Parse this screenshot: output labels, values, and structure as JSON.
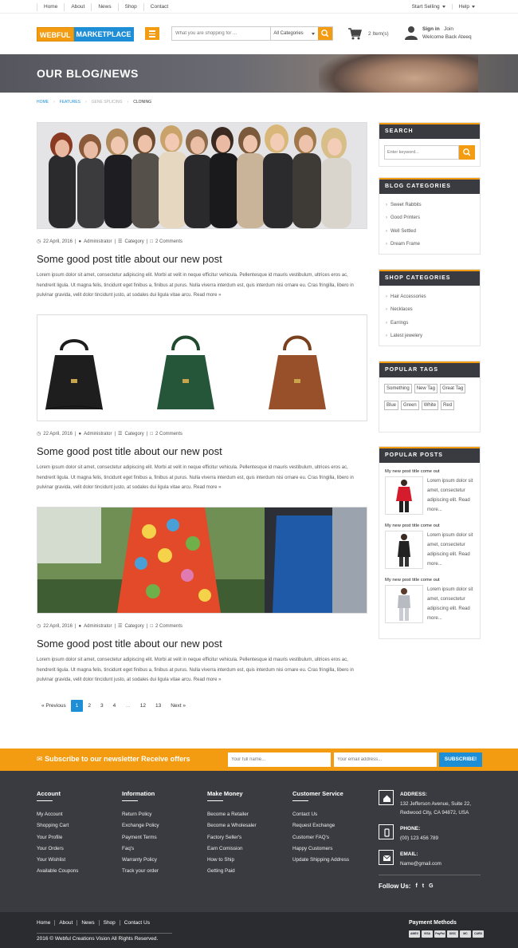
{
  "topbar": {
    "nav": [
      "Home",
      "About",
      "News",
      "Shop",
      "Contact"
    ],
    "start_selling": "Start Selling",
    "help": "Help"
  },
  "header": {
    "logo_part1": "WEBFUL",
    "logo_part2": "MARKETPLACE",
    "search_placeholder": "What you are shopping for ...",
    "category_select": "All Categories",
    "cart_count": "2 Item(s)",
    "sign_in": "Sign in",
    "join": "Join",
    "welcome": "Welcome Back Ateeq"
  },
  "banner": {
    "title": "OUR BLOG/NEWS"
  },
  "breadcrumb": [
    "HOME",
    "FEATURES",
    "GENE SPLICING",
    "CLONING"
  ],
  "posts": [
    {
      "date": "22 April, 2016",
      "author": "Administrator",
      "category": "Category",
      "comments": "2 Comments",
      "title": "Some good post title about our new post",
      "excerpt": "Lorem ipsum dolor sit amet, consectetur adipiscing elit. Morbi at velit in neque efficitur vehicula. Pellentesque id mauris vestibulum, ultrices eros ac, hendrerit ligula. Ut magna felis, tincidunt eget finibus a, finibus at purus. Nulla viverra interdum est, quis interdum nisi ornare eu. Cras fringilla, libero in pulvinar gravida, velit dolor tincidunt justo, at sodales dui ligula vitae arcu.",
      "read_more": "Read more »"
    },
    {
      "date": "22 April, 2016",
      "author": "Administrator",
      "category": "Category",
      "comments": "2 Comments",
      "title": "Some good post title about our new post",
      "excerpt": "Lorem ipsum dolor sit amet, consectetur adipiscing elit. Morbi at velit in neque efficitur vehicula. Pellentesque id mauris vestibulum, ultrices eros ac, hendrerit ligula. Ut magna felis, tincidunt eget finibus a, finibus at purus. Nulla viverra interdum est, quis interdum nisi ornare eu. Cras fringilla, libero in pulvinar gravida, velit dolor tincidunt justo, at sodales dui ligula vitae arcu.",
      "read_more": "Read more »"
    },
    {
      "date": "22 April, 2016",
      "author": "Administrator",
      "category": "Category",
      "comments": "2 Comments",
      "title": "Some good post title about our new post",
      "excerpt": "Lorem ipsum dolor sit amet, consectetur adipiscing elit. Morbi at velit in neque efficitur vehicula. Pellentesque id mauris vestibulum, ultrices eros ac, hendrerit ligula. Ut magna felis, tincidunt eget finibus a, finibus at purus. Nulla viverra interdum est, quis interdum nisi ornare eu. Cras fringilla, libero in pulvinar gravida, velit dolor tincidunt justo, at sodales dui ligula vitae arcu.",
      "read_more": "Read more »"
    }
  ],
  "pagination": {
    "prev": "« Previous",
    "pages": [
      "1",
      "2",
      "3",
      "4",
      "…",
      "12",
      "13"
    ],
    "active": "1",
    "next": "Next »"
  },
  "sidebar": {
    "search": {
      "title": "SEARCH",
      "placeholder": "Enter keyword..."
    },
    "blog_categories": {
      "title": "BLOG CATEGORIES",
      "items": [
        "Sweet Rabbits",
        "Good Printers",
        "Well Settled",
        "Dream Frame"
      ]
    },
    "shop_categories": {
      "title": "SHOP CATEGORIES",
      "items": [
        "Hair Accessories",
        "Necklaces",
        "Earrings",
        "Latest jewelery"
      ]
    },
    "popular_tags": {
      "title": "POPULAR TAGS",
      "tags": [
        "Something",
        "New Tag",
        "Great Tag",
        "Blue",
        "Green",
        "White",
        "Red"
      ]
    },
    "popular_posts": {
      "title": "POPULAR POSTS",
      "items": [
        {
          "title": "My new post title come out",
          "desc": "Lorem ipsum dolor sit amet, consectetur adipiscing elit. Read more..."
        },
        {
          "title": "My new post title come out",
          "desc": "Lorem ipsum dolor sit amet, consectetur adipiscing elit. Read more..."
        },
        {
          "title": "My new post title come out",
          "desc": "Lorem ipsum dolor sit amet, consectetur adipiscing elit. Read more..."
        }
      ]
    }
  },
  "newsletter": {
    "title": "Subscribe to our newsletter Receive offers",
    "name_placeholder": "Your full name...",
    "email_placeholder": "Your email address...",
    "button": "SUBSCRIBE!"
  },
  "footer": {
    "columns": [
      {
        "title": "Account",
        "links": [
          "My Account",
          "Shopping Cart",
          "Your Profile",
          "Your Orders",
          "Your Wishlist",
          "Available Coupons"
        ]
      },
      {
        "title": "Information",
        "links": [
          "Return Policy",
          "Exchange Policy",
          "Payment Terms",
          "Faq's",
          "Warranty Policy",
          "Track your order"
        ]
      },
      {
        "title": "Make Money",
        "links": [
          "Become a Retailer",
          "Become a Wholesaler",
          "Factory Seller's",
          "Earn Comission",
          "How to Ship",
          "Getting Paid"
        ]
      },
      {
        "title": "Customer Service",
        "links": [
          "Contact Us",
          "Request Exchange",
          "Customer FAQ's",
          "Happy Customers",
          "Update Shipping Address"
        ]
      }
    ],
    "address_label": "ADDRESS:",
    "address": "132 Jefferson Avenue, Suite 22, Redwood City, CA 94872, USA",
    "phone_label": "PHONE:",
    "phone": "(00) 123 456 789",
    "email_label": "EMAIL:",
    "email": "Name@gmail.com",
    "follow": "Follow Us:",
    "social": [
      "f",
      "t",
      "G"
    ]
  },
  "bottom": {
    "links": [
      "Home",
      "About",
      "News",
      "Shop",
      "Contact Us"
    ],
    "copyright": "2016 © Webful Creations Vision All Rights Reserved.",
    "payment_title": "Payment Methods",
    "cards": [
      "AMEX",
      "VISA",
      "PayPal",
      "DISC",
      "MC",
      "CARD"
    ]
  },
  "colors": {
    "accent": "#f39c12",
    "brand_blue": "#1e8fd6",
    "footer_bg": "#3a3b40"
  }
}
